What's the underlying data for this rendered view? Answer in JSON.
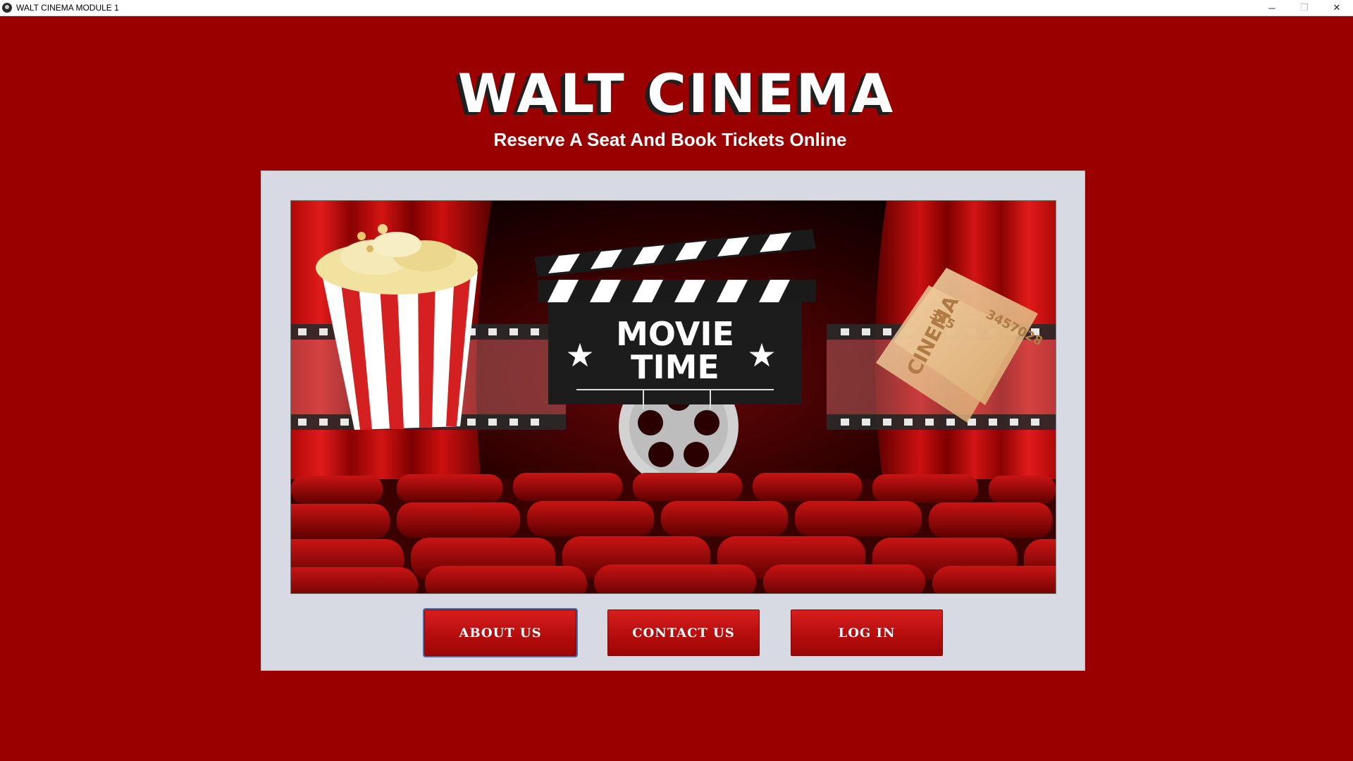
{
  "window": {
    "title": "WALT CINEMA MODULE 1",
    "icon": "cinema-app-icon",
    "controls": {
      "minimize": "─",
      "restore": "❐",
      "close": "✕"
    }
  },
  "header": {
    "title": "WALT CINEMA",
    "subtitle": "Reserve A Seat And Book Tickets Online"
  },
  "hero": {
    "clapper_line1": "MOVIE",
    "clapper_line2": "TIME",
    "ticket_number_1": "3457028",
    "ticket_number_2": "345",
    "ticket_text": "CINEMA"
  },
  "buttons": {
    "about": "ABOUT US",
    "contact": "CONTACT US",
    "login": "LOG IN"
  },
  "colors": {
    "background": "#9b0000",
    "panel": "#d7dae2",
    "button": "#c41414"
  }
}
